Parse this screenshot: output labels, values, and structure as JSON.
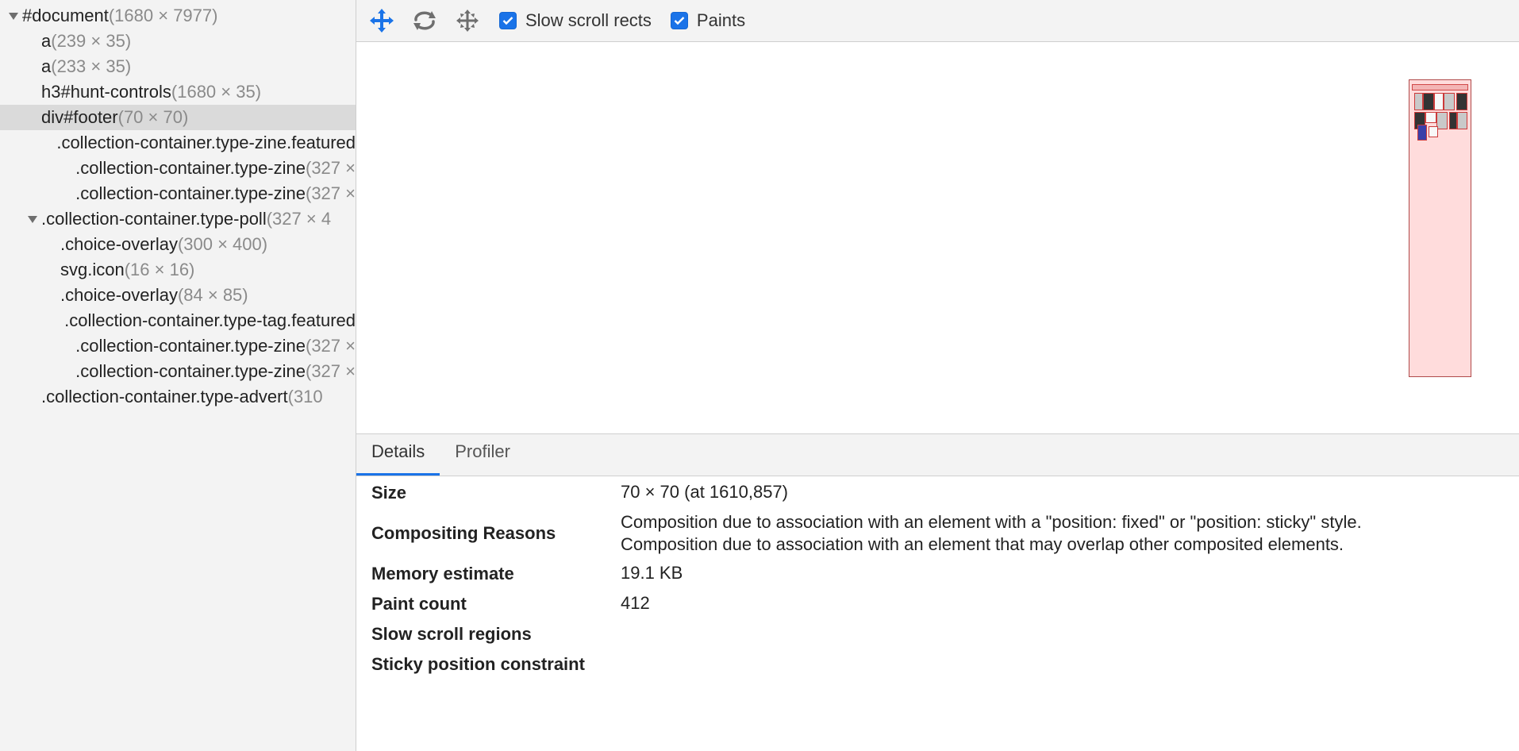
{
  "tree": {
    "items": [
      {
        "name": "#document",
        "dims": "(1680 × 7977)",
        "arrow": "down",
        "level": 0,
        "selected": false
      },
      {
        "name": "a",
        "dims": "(239 × 35)",
        "arrow": "none",
        "level": 1,
        "selected": false
      },
      {
        "name": "a",
        "dims": "(233 × 35)",
        "arrow": "none",
        "level": 1,
        "selected": false
      },
      {
        "name": "h3#hunt-controls",
        "dims": "(1680 × 35)",
        "arrow": "none",
        "level": 1,
        "selected": false
      },
      {
        "name": "div#footer",
        "dims": "(70 × 70)",
        "arrow": "none",
        "level": 1,
        "selected": true
      },
      {
        "name": ".collection-container.type-zine.featured",
        "dims": "",
        "arrow": "right",
        "level": 1,
        "selected": false
      },
      {
        "name": ".collection-container.type-zine",
        "dims": "(327 × ",
        "arrow": "right",
        "level": 1,
        "selected": false
      },
      {
        "name": ".collection-container.type-zine",
        "dims": "(327 × ",
        "arrow": "right",
        "level": 1,
        "selected": false
      },
      {
        "name": ".collection-container.type-poll",
        "dims": "(327 × 4",
        "arrow": "down",
        "level": 1,
        "selected": false
      },
      {
        "name": ".choice-overlay",
        "dims": "(300 × 400)",
        "arrow": "none",
        "level": 2,
        "selected": false
      },
      {
        "name": "svg.icon",
        "dims": "(16 × 16)",
        "arrow": "none",
        "level": 2,
        "selected": false
      },
      {
        "name": ".choice-overlay",
        "dims": "(84 × 85)",
        "arrow": "none",
        "level": 2,
        "selected": false
      },
      {
        "name": ".collection-container.type-tag.featured",
        "dims": "",
        "arrow": "right",
        "level": 1,
        "selected": false
      },
      {
        "name": ".collection-container.type-zine",
        "dims": "(327 × ",
        "arrow": "right",
        "level": 1,
        "selected": false
      },
      {
        "name": ".collection-container.type-zine",
        "dims": "(327 × ",
        "arrow": "right",
        "level": 1,
        "selected": false
      },
      {
        "name": ".collection-container.type-advert",
        "dims": "(310",
        "arrow": "none",
        "level": 1,
        "selected": false
      }
    ]
  },
  "toolbar": {
    "pan_icon": "pan-mode-icon",
    "rotate_icon": "rotate-mode-icon",
    "reset_icon": "reset-transform-icon",
    "slow_scroll_label": "Slow scroll rects",
    "slow_scroll_checked": true,
    "paints_label": "Paints",
    "paints_checked": true
  },
  "tabs": {
    "details": "Details",
    "profiler": "Profiler",
    "active": "details"
  },
  "details": {
    "size_label": "Size",
    "size_value": "70 × 70 (at 1610,857)",
    "reasons_label": "Compositing Reasons",
    "reason_1": "Composition due to association with an element with a \"position: fixed\" or \"position: sticky\" style.",
    "reason_2": "Composition due to association with an element that may overlap other composited elements.",
    "memory_label": "Memory estimate",
    "memory_value": "19.1 KB",
    "paint_label": "Paint count",
    "paint_value": "412",
    "slow_scroll_label": "Slow scroll regions",
    "slow_scroll_value": "",
    "sticky_label": "Sticky position constraint",
    "sticky_value": ""
  },
  "colors": {
    "accent": "#1a73e8",
    "layer_fill": "#ffdcdc",
    "layer_border": "#b04a4a"
  }
}
